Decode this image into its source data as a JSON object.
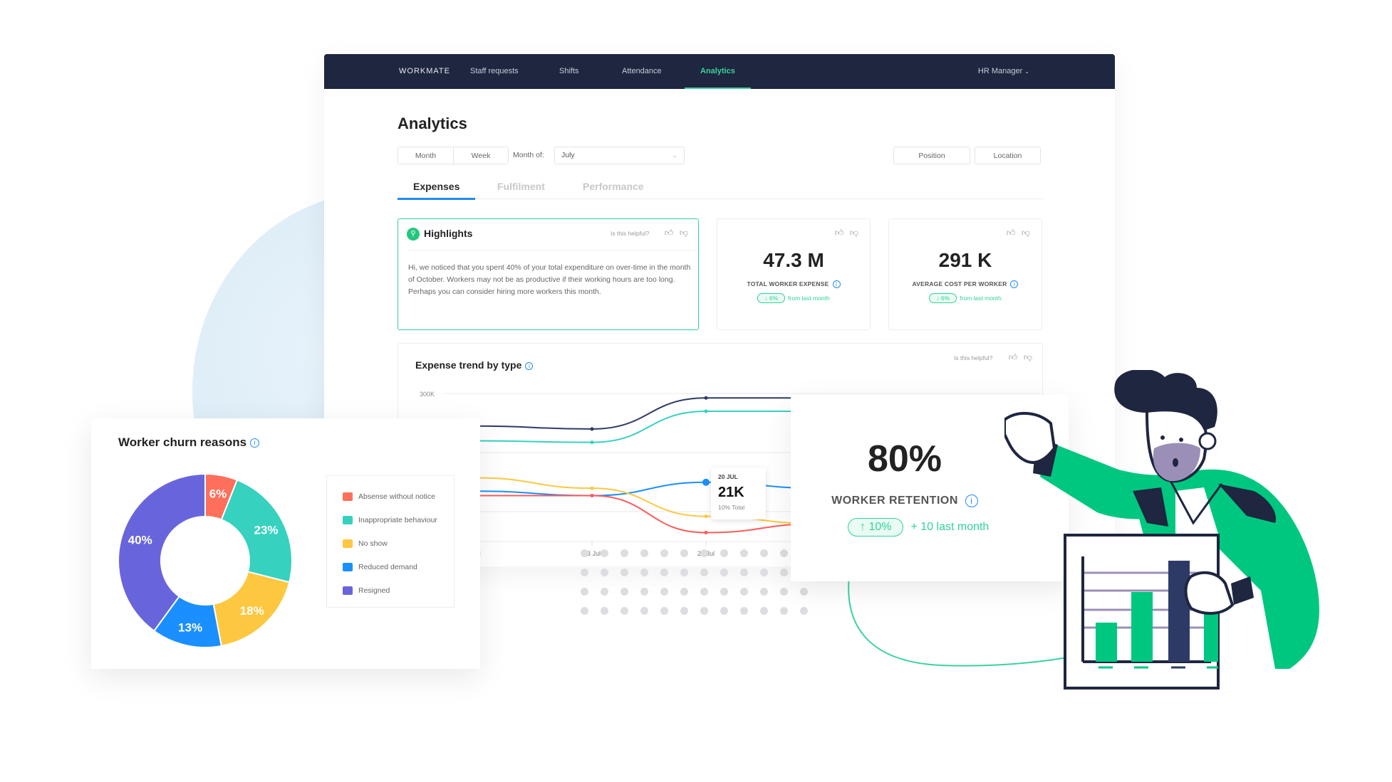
{
  "nav": {
    "brand": "WORKMATE",
    "items": [
      {
        "label": "Staff requests",
        "active": false
      },
      {
        "label": "Shifts",
        "active": false
      },
      {
        "label": "Attendance",
        "active": false
      },
      {
        "label": "Analytics",
        "active": true
      }
    ],
    "user": "HR Manager"
  },
  "page": {
    "title": "Analytics",
    "period_toggle": [
      "Month",
      "Week"
    ],
    "month_label": "Month of:",
    "month_value": "July",
    "filters": [
      "Position",
      "Location"
    ],
    "tabs": [
      {
        "label": "Expenses",
        "active": true
      },
      {
        "label": "Fulfilment",
        "active": false
      },
      {
        "label": "Performance",
        "active": false
      }
    ]
  },
  "highlights": {
    "title": "Highlights",
    "helpful_prompt": "Is this helpful?",
    "body": "Hi, we noticed that you spent 40% of your total expenditure on over-time in the month of October. Workers may not be as productive if their working hours are too long. Perhaps you can consider hiring more workers this month."
  },
  "kpis": [
    {
      "value": "47.3 M",
      "label": "TOTAL WORKER EXPENSE",
      "delta": "6%",
      "delta_direction": "down",
      "delta_suffix": "from last month"
    },
    {
      "value": "291 K",
      "label": "AVERAGE COST PER WORKER",
      "delta": "6%",
      "delta_direction": "down",
      "delta_suffix": "from last month"
    }
  ],
  "trend": {
    "title": "Expense trend by type",
    "helpful_prompt": "Is this helpful?",
    "y_tick": "300K",
    "x_ticks": [
      "Jul",
      "13 Jul",
      "20 Jul"
    ],
    "tooltip": {
      "date": "20 JUL",
      "value": "21K",
      "sub": "10% Total"
    }
  },
  "retention": {
    "value": "80%",
    "label": "WORKER RETENTION",
    "delta": "10%",
    "delta_direction": "up",
    "delta_suffix": "+ 10 last month"
  },
  "churn": {
    "title": "Worker churn reasons"
  },
  "colors": {
    "nav_bg": "#1e2640",
    "accent_green": "#2fd39a",
    "accent_blue": "#1e8cf0",
    "red": "#ff6f5b",
    "teal": "#36d1bf",
    "yellow": "#fdc83f",
    "blue": "#1a8fff",
    "purple": "#6865dc"
  },
  "chart_data": [
    {
      "type": "pie",
      "title": "Worker churn reasons",
      "categories": [
        "Absense without notice",
        "Inappropriate behaviour",
        "No show",
        "Reduced demand",
        "Resigned"
      ],
      "values": [
        6,
        23,
        18,
        13,
        40
      ],
      "labels": [
        "6%",
        "23%",
        "18%",
        "13%",
        "40%"
      ],
      "colors": [
        "#ff6f5b",
        "#36d1bf",
        "#fdc83f",
        "#1a8fff",
        "#6865dc"
      ],
      "donut": true,
      "legend": "right"
    },
    {
      "type": "line",
      "title": "Expense trend by type",
      "x": [
        "Jul",
        "13 Jul",
        "20 Jul"
      ],
      "y_tick_labels": [
        "300K"
      ],
      "series": [
        {
          "name": "navy",
          "color": "#2e3a66",
          "values": [
            0.78,
            0.76,
            0.97,
            0.97
          ]
        },
        {
          "name": "teal",
          "color": "#36d1bf",
          "values": [
            0.68,
            0.67,
            0.88,
            0.88
          ]
        },
        {
          "name": "blue",
          "color": "#1a8fff",
          "values": [
            0.34,
            0.31,
            0.4,
            0.36
          ]
        },
        {
          "name": "yellow",
          "color": "#fdc83f",
          "values": [
            0.43,
            0.36,
            0.17,
            0.12
          ]
        },
        {
          "name": "red",
          "color": "#ff5a5a",
          "values": [
            0.31,
            0.31,
            0.06,
            0.12
          ]
        }
      ],
      "tooltip": {
        "x": "20 Jul",
        "value": "21K",
        "share": "10% Total"
      },
      "grid": true
    }
  ]
}
